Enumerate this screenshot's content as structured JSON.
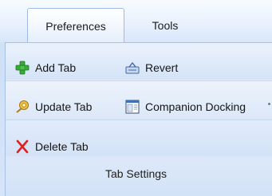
{
  "tabs": [
    {
      "label": "Preferences",
      "active": true
    },
    {
      "label": "Tools",
      "active": false
    }
  ],
  "ribbon": {
    "buttons": {
      "add_tab": "Add Tab",
      "revert": "Revert",
      "update_tab": "Update Tab",
      "companion_docking": "Companion Docking",
      "delete_tab": "Delete Tab"
    },
    "group_label": "Tab Settings"
  },
  "icons": {
    "add_tab": "plus-icon",
    "revert": "revert-icon",
    "update_tab": "update-icon",
    "companion_docking": "docking-icon",
    "delete_tab": "delete-icon"
  },
  "colors": {
    "plus": "#3aa83a",
    "delete": "#e0201c",
    "accent_border": "#9fbbe4"
  }
}
